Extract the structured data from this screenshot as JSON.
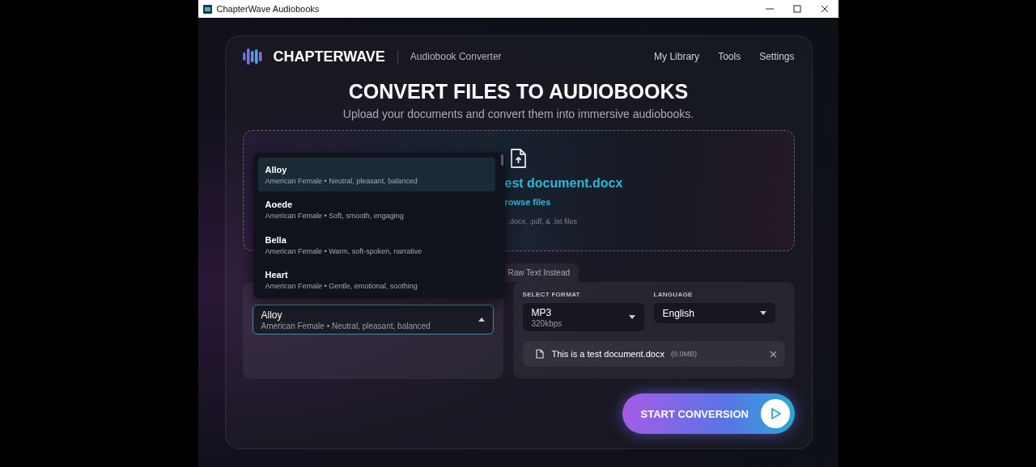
{
  "window": {
    "title": "ChapterWave Audiobooks"
  },
  "header": {
    "brand": "CHAPTERWAVE",
    "subtitle": "Audiobook Converter",
    "nav": [
      {
        "label": "My Library"
      },
      {
        "label": "Tools"
      },
      {
        "label": "Settings"
      }
    ]
  },
  "hero": {
    "title": "CONVERT FILES TO AUDIOBOOKS",
    "subtitle": "Upload your documents and convert them into immersive audiobooks."
  },
  "dropzone": {
    "file_name": "est document.docx",
    "browse_link": "rowse files",
    "hint": ".docx, .pdf, & .txt files"
  },
  "input_tabs": [
    {
      "label": "Raw Text Instead",
      "selected": false
    }
  ],
  "voice_select": {
    "value": "Alloy",
    "detail": "American Female • Neutral, pleasant, balanced",
    "expanded": true
  },
  "voice_options": [
    {
      "name": "Alloy",
      "detail": "American Female • Neutral, pleasant, balanced",
      "selected": true
    },
    {
      "name": "Aoede",
      "detail": "American Female • Soft, smooth, engaging",
      "selected": false
    },
    {
      "name": "Bella",
      "detail": "American Female • Warm, soft-spoken, narrative",
      "selected": false
    },
    {
      "name": "Heart",
      "detail": "American Female • Gentle, emotional, soothing",
      "selected": false
    }
  ],
  "format": {
    "label": "SELECT FORMAT",
    "value": "MP3",
    "detail": "320kbps"
  },
  "language": {
    "label": "LANGUAGE",
    "value": "English"
  },
  "file": {
    "name": "This is a test document.docx",
    "size": "(0.0MB)"
  },
  "start_button": {
    "label": "START CONVERSION"
  }
}
